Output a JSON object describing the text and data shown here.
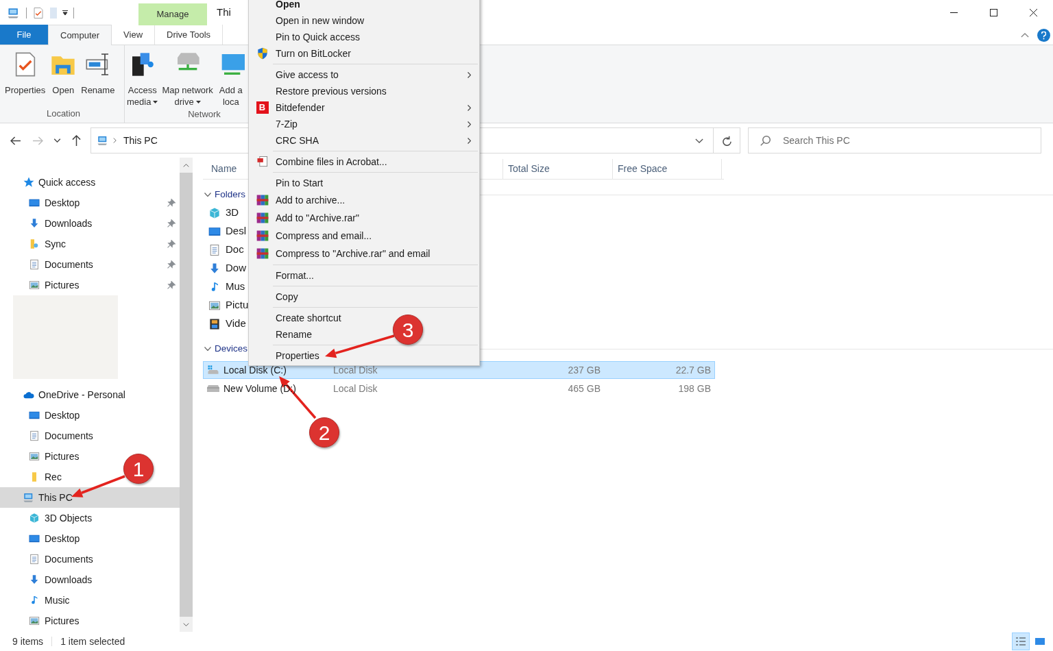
{
  "title_bar": {
    "title": "Thi",
    "context_tab": "Manage"
  },
  "ribbon_tabs": [
    {
      "label": "File",
      "kind": "file",
      "selected": false
    },
    {
      "label": "Computer",
      "kind": "tab",
      "selected": true
    },
    {
      "label": "View",
      "kind": "tab",
      "selected": false
    },
    {
      "label": "Drive Tools",
      "kind": "context",
      "selected": false
    }
  ],
  "ribbon_groups": [
    {
      "label": "Location",
      "buttons": [
        {
          "lines": [
            "Properties"
          ],
          "dropdown": false
        },
        {
          "lines": [
            "Open"
          ],
          "dropdown": false
        },
        {
          "lines": [
            "Rename"
          ],
          "dropdown": false
        }
      ]
    },
    {
      "label": "Network",
      "buttons": [
        {
          "lines": [
            "Access",
            "media"
          ],
          "dropdown": true
        },
        {
          "lines": [
            "Map network",
            "drive"
          ],
          "dropdown": true
        },
        {
          "lines": [
            "Add a",
            "loca"
          ],
          "dropdown": false
        }
      ]
    }
  ],
  "nav_buttons": [
    {
      "kind": "back",
      "disabled": false
    },
    {
      "kind": "forward",
      "disabled": true
    },
    {
      "kind": "recent",
      "disabled": false
    },
    {
      "kind": "up",
      "disabled": false
    }
  ],
  "address_bar": {
    "path": "This PC"
  },
  "search": {
    "placeholder": "Search This PC"
  },
  "sidebar": [
    {
      "kind": "node",
      "label": "Quick access",
      "selected": false,
      "children": [
        {
          "label": "Desktop",
          "pinned": true,
          "selected": false
        },
        {
          "label": "Downloads",
          "pinned": true,
          "selected": false
        },
        {
          "label": "Sync",
          "pinned": true,
          "selected": false
        },
        {
          "label": "Documents",
          "pinned": true,
          "selected": false
        },
        {
          "label": "Pictures",
          "pinned": true,
          "selected": false
        }
      ]
    },
    {
      "kind": "blank"
    },
    {
      "kind": "node",
      "label": "OneDrive - Personal",
      "selected": false,
      "children": [
        {
          "label": "Desktop",
          "pinned": false,
          "selected": false
        },
        {
          "label": "Documents",
          "pinned": false,
          "selected": false
        },
        {
          "label": "Pictures",
          "pinned": false,
          "selected": false
        },
        {
          "label": "Rec",
          "pinned": false,
          "selected": false
        }
      ]
    },
    {
      "kind": "node",
      "label": "This PC",
      "selected": true,
      "children": [
        {
          "label": "3D Objects",
          "pinned": false,
          "selected": false
        },
        {
          "label": "Desktop",
          "pinned": false,
          "selected": false
        },
        {
          "label": "Documents",
          "pinned": false,
          "selected": false
        },
        {
          "label": "Downloads",
          "pinned": false,
          "selected": false
        },
        {
          "label": "Music",
          "pinned": false,
          "selected": false
        },
        {
          "label": "Pictures",
          "pinned": false,
          "selected": false
        }
      ]
    }
  ],
  "columns": [
    {
      "label": "Name"
    },
    {
      "label": "Total Size"
    },
    {
      "label": "Free Space"
    }
  ],
  "groups": [
    {
      "label": "Folders",
      "expanded": true,
      "items": [
        {
          "name": "3D",
          "selected": false
        },
        {
          "name": "Desl",
          "selected": false
        },
        {
          "name": "Doc",
          "selected": false
        },
        {
          "name": "Dow",
          "selected": false
        },
        {
          "name": "Mus",
          "selected": false
        },
        {
          "name": "Pictu",
          "selected": false
        },
        {
          "name": "Vide",
          "selected": false
        }
      ]
    },
    {
      "label": "Devices",
      "expanded": true,
      "items": [
        {
          "name": "Local Disk (C:)",
          "type": "Local Disk",
          "total": "237 GB",
          "free": "22.7 GB",
          "selected": true
        },
        {
          "name": "New Volume (D:)",
          "type": "Local Disk",
          "total": "465 GB",
          "free": "198 GB",
          "selected": false
        }
      ]
    }
  ],
  "context_menu": [
    {
      "kind": "item",
      "label": "Open",
      "default": true,
      "submenu": false
    },
    {
      "kind": "item",
      "label": "Open in new window",
      "default": false,
      "submenu": false
    },
    {
      "kind": "item",
      "label": "Pin to Quick access",
      "default": false,
      "submenu": false
    },
    {
      "kind": "item",
      "label": "Turn on BitLocker",
      "default": false,
      "submenu": false
    },
    {
      "kind": "separator"
    },
    {
      "kind": "item",
      "label": "Give access to",
      "default": false,
      "submenu": true
    },
    {
      "kind": "item",
      "label": "Restore previous versions",
      "default": false,
      "submenu": false
    },
    {
      "kind": "item",
      "label": "Bitdefender",
      "icon_text": "B",
      "default": false,
      "submenu": true
    },
    {
      "kind": "item",
      "label": "7-Zip",
      "default": false,
      "submenu": true
    },
    {
      "kind": "item",
      "label": "CRC SHA",
      "default": false,
      "submenu": true
    },
    {
      "kind": "separator"
    },
    {
      "kind": "item",
      "label": "Combine files in Acrobat...",
      "default": false,
      "submenu": false
    },
    {
      "kind": "separator"
    },
    {
      "kind": "item",
      "label": "Pin to Start",
      "default": false,
      "submenu": false
    },
    {
      "kind": "item",
      "label": "Add to archive...",
      "default": false,
      "submenu": false
    },
    {
      "kind": "item",
      "label": "Add to \"Archive.rar\"",
      "default": false,
      "submenu": false
    },
    {
      "kind": "item",
      "label": "Compress and email...",
      "default": false,
      "submenu": false
    },
    {
      "kind": "item",
      "label": "Compress to \"Archive.rar\" and email",
      "default": false,
      "submenu": false
    },
    {
      "kind": "separator"
    },
    {
      "kind": "item",
      "label": "Format...",
      "default": false,
      "submenu": false
    },
    {
      "kind": "separator"
    },
    {
      "kind": "item",
      "label": "Copy",
      "default": false,
      "submenu": false
    },
    {
      "kind": "separator"
    },
    {
      "kind": "item",
      "label": "Create shortcut",
      "default": false,
      "submenu": false
    },
    {
      "kind": "item",
      "label": "Rename",
      "default": false,
      "submenu": false
    },
    {
      "kind": "separator"
    },
    {
      "kind": "item",
      "label": "Properties",
      "default": false,
      "submenu": false
    }
  ],
  "annotations": [
    {
      "number": "1"
    },
    {
      "number": "2"
    },
    {
      "number": "3"
    }
  ],
  "status_bar": {
    "item_count": "9 items",
    "selection": "1 item selected",
    "views": [
      {
        "kind": "details",
        "selected": true
      },
      {
        "kind": "large-icons",
        "selected": false
      }
    ]
  }
}
